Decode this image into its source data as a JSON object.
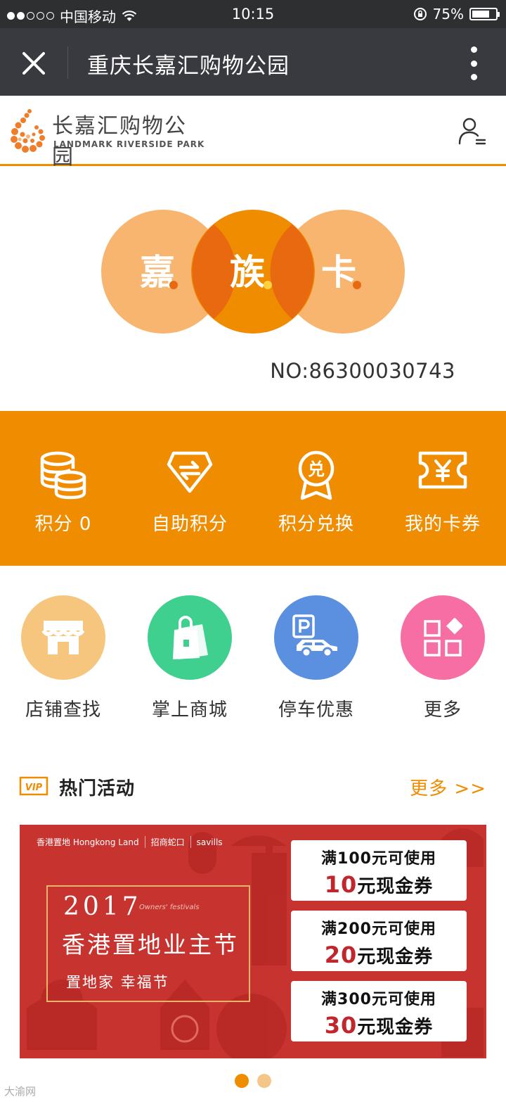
{
  "status_bar": {
    "carrier": "中国移动",
    "time": "10:15",
    "battery": "75%",
    "battery_level": 0.75
  },
  "title_bar": {
    "title": "重庆长嘉汇购物公园"
  },
  "header": {
    "logo_cn": "长嘉汇购物公园",
    "logo_en": "LANDMARK RIVERSIDE PARK"
  },
  "card": {
    "chars": [
      "嘉",
      "族",
      "卡"
    ],
    "number": "NO:86300030743"
  },
  "member_menu": [
    {
      "label": "积分 0",
      "icon": "coins-icon"
    },
    {
      "label": "自助积分",
      "icon": "self-points-icon"
    },
    {
      "label": "积分兑换",
      "icon": "redeem-badge-icon"
    },
    {
      "label": "我的卡券",
      "icon": "coupon-ticket-icon"
    }
  ],
  "quick_nav": [
    {
      "label": "店铺查找",
      "icon": "storefront-icon",
      "color": "#f6c67f"
    },
    {
      "label": "掌上商城",
      "icon": "shopping-bag-icon",
      "color": "#3fcf8e"
    },
    {
      "label": "停车优惠",
      "icon": "parking-car-icon",
      "color": "#5b8fe0"
    },
    {
      "label": "更多",
      "icon": "grid-more-icon",
      "color": "#f76ea5"
    }
  ],
  "hot_activity": {
    "badge": "VIP",
    "title": "热门活动",
    "more": "更多 >>"
  },
  "banner": {
    "brands": [
      "香港置地 Hongkong Land",
      "招商蛇口",
      "savills"
    ],
    "year": "2017",
    "subtitle_en": "Owners' festivals",
    "festival": "香港置地业主节",
    "slogan": "置地家  幸福节",
    "coupons": [
      {
        "line1": "满100元可使用",
        "amount": "10",
        "line2": "元现金券"
      },
      {
        "line1": "满200元可使用",
        "amount": "20",
        "line2": "元现金券"
      },
      {
        "line1": "满300元可使用",
        "amount": "30",
        "line2": "元现金券"
      }
    ]
  },
  "carousel": {
    "total": 2,
    "active": 1
  },
  "watermark": "大渝网"
}
